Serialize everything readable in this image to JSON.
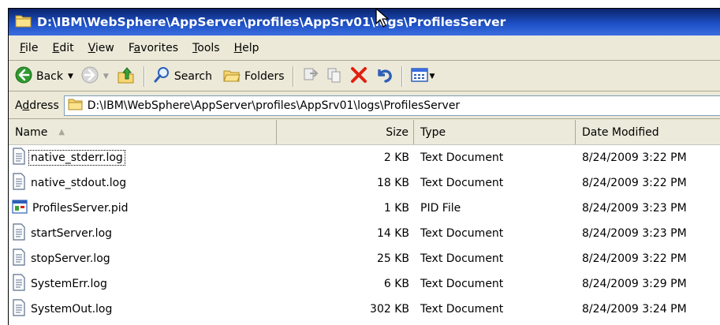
{
  "window": {
    "title": "D:\\IBM\\WebSphere\\AppServer\\profiles\\AppSrv01\\logs\\ProfilesServer"
  },
  "menu": [
    {
      "mnemonic": "F",
      "rest": "ile"
    },
    {
      "mnemonic": "E",
      "rest": "dit"
    },
    {
      "mnemonic": "V",
      "rest": "iew"
    },
    {
      "pre": "F",
      "mnemonic": "a",
      "rest": "vorites"
    },
    {
      "mnemonic": "T",
      "rest": "ools"
    },
    {
      "mnemonic": "H",
      "rest": "elp"
    }
  ],
  "toolbar": {
    "back_label": "Back",
    "search_label": "Search",
    "folders_label": "Folders"
  },
  "address": {
    "label_pre": "A",
    "label_mnemonic": "d",
    "label_rest": "dress",
    "value": "D:\\IBM\\WebSphere\\AppServer\\profiles\\AppSrv01\\logs\\ProfilesServer"
  },
  "columns": {
    "name": "Name",
    "size": "Size",
    "type": "Type",
    "date": "Date Modified"
  },
  "files": [
    {
      "name": "native_stderr.log",
      "size": "2 KB",
      "type": "Text Document",
      "date": "8/24/2009 3:22 PM",
      "icon": "text-file-icon"
    },
    {
      "name": "native_stdout.log",
      "size": "18 KB",
      "type": "Text Document",
      "date": "8/24/2009 3:22 PM",
      "icon": "text-file-icon"
    },
    {
      "name": "ProfilesServer.pid",
      "size": "1 KB",
      "type": "PID File",
      "date": "8/24/2009 3:23 PM",
      "icon": "pid-file-icon"
    },
    {
      "name": "startServer.log",
      "size": "14 KB",
      "type": "Text Document",
      "date": "8/24/2009 3:23 PM",
      "icon": "text-file-icon"
    },
    {
      "name": "stopServer.log",
      "size": "25 KB",
      "type": "Text Document",
      "date": "8/24/2009 3:22 PM",
      "icon": "text-file-icon"
    },
    {
      "name": "SystemErr.log",
      "size": "6 KB",
      "type": "Text Document",
      "date": "8/24/2009 3:29 PM",
      "icon": "text-file-icon"
    },
    {
      "name": "SystemOut.log",
      "size": "302 KB",
      "type": "Text Document",
      "date": "8/24/2009 3:24 PM",
      "icon": "text-file-icon"
    }
  ],
  "colors": {
    "title_bar": "#1d4fc4",
    "window_face": "#ece9d8",
    "delete_red": "#e02010",
    "back_green": "#2f9a2f"
  }
}
